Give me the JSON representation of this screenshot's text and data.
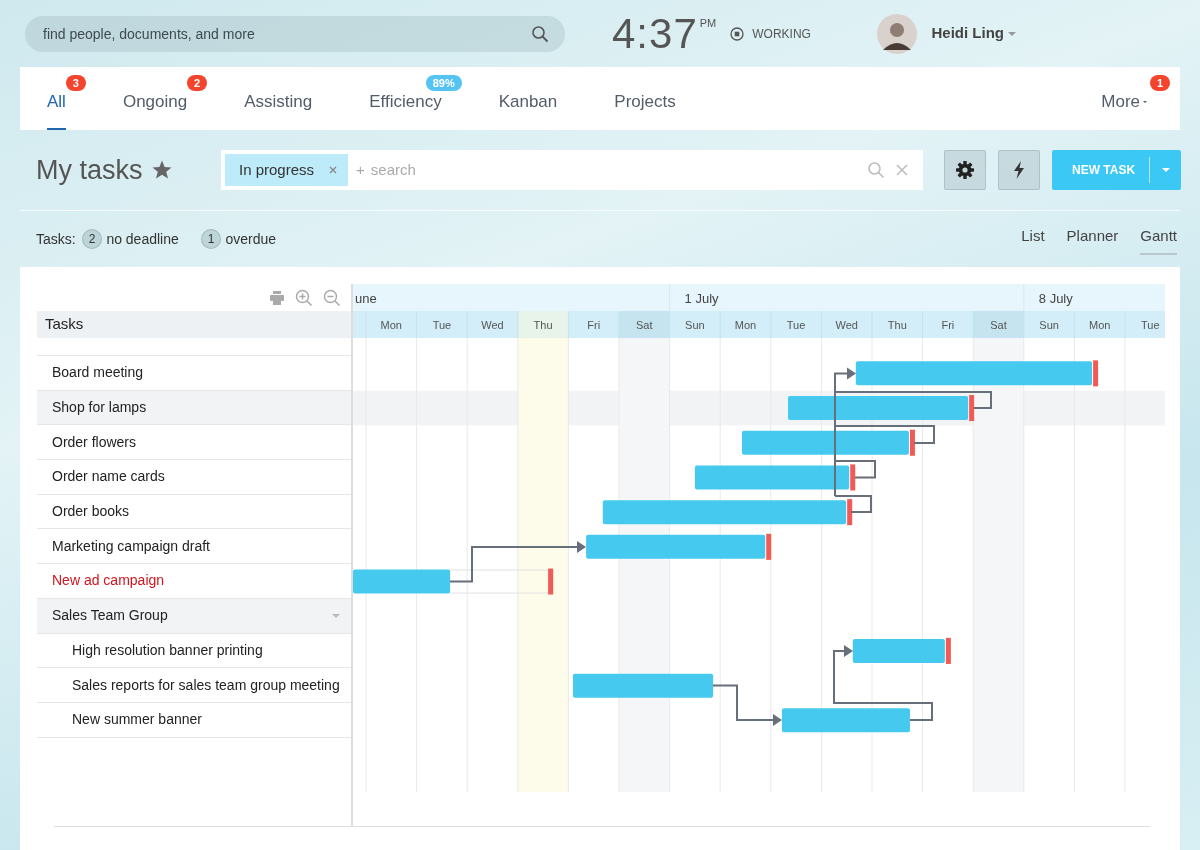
{
  "search": {
    "placeholder": "find people, documents, and more"
  },
  "clock": {
    "time": "4:37",
    "period": "PM"
  },
  "status": {
    "label": "WORKING"
  },
  "user": {
    "name": "Heidi Ling"
  },
  "tabs": [
    {
      "label": "All",
      "selected": true,
      "badge": {
        "text": "3",
        "color": "#f4442e"
      }
    },
    {
      "label": "Ongoing",
      "selected": false,
      "badge": {
        "text": "2",
        "color": "#f4442e"
      }
    },
    {
      "label": "Assisting",
      "selected": false
    },
    {
      "label": "Efficiency",
      "selected": false,
      "badge": {
        "text": "89%",
        "color": "#55c4f2"
      }
    },
    {
      "label": "Kanban",
      "selected": false
    },
    {
      "label": "Projects",
      "selected": false
    },
    {
      "label": "More",
      "selected": false,
      "dropdown": true,
      "badge": {
        "text": "1",
        "color": "#f4442e"
      }
    }
  ],
  "page": {
    "title": "My tasks"
  },
  "filter": {
    "tags": [
      {
        "label": "In progress"
      }
    ],
    "prefix": "+",
    "placeholder": "search"
  },
  "actions": {
    "new_task": "NEW TASK"
  },
  "counters": {
    "label": "Tasks:",
    "items": [
      {
        "count": "2",
        "label": "no deadline"
      },
      {
        "count": "1",
        "label": "overdue"
      }
    ]
  },
  "views": [
    {
      "label": "List",
      "selected": false
    },
    {
      "label": "Planner",
      "selected": false
    },
    {
      "label": "Gantt",
      "selected": true
    }
  ],
  "gantt": {
    "column_header": "Tasks",
    "months": [
      {
        "label": "une",
        "days": [
          {
            "label": "Mon",
            "kind": "weekday"
          },
          {
            "label": "Tue",
            "kind": "weekday"
          },
          {
            "label": "Wed",
            "kind": "weekday"
          },
          {
            "label": "Thu",
            "kind": "today"
          },
          {
            "label": "Fri",
            "kind": "weekday"
          },
          {
            "label": "Sat",
            "kind": "weekend"
          }
        ]
      },
      {
        "label": "1 July",
        "days": [
          {
            "label": "Sun",
            "kind": "weekday"
          },
          {
            "label": "Mon",
            "kind": "weekday"
          },
          {
            "label": "Tue",
            "kind": "weekday"
          },
          {
            "label": "Wed",
            "kind": "weekday"
          },
          {
            "label": "Thu",
            "kind": "weekday"
          },
          {
            "label": "Fri",
            "kind": "weekday"
          },
          {
            "label": "Sat",
            "kind": "weekend"
          }
        ]
      },
      {
        "label": "8 July",
        "days": [
          {
            "label": "Sun",
            "kind": "weekday"
          },
          {
            "label": "Mon",
            "kind": "weekday"
          },
          {
            "label": "Tue",
            "kind": "weekday"
          }
        ]
      }
    ],
    "rows": [
      {
        "name": "Board meeting",
        "kind": "task",
        "selected": false,
        "overdue": false,
        "deadline": true
      },
      {
        "name": "Shop for lamps",
        "kind": "task",
        "selected": true,
        "overdue": false,
        "deadline": true
      },
      {
        "name": "Order flowers",
        "kind": "task",
        "selected": false,
        "overdue": false,
        "deadline": true
      },
      {
        "name": "Order name cards",
        "kind": "task",
        "selected": false,
        "overdue": false,
        "deadline": true
      },
      {
        "name": "Order books",
        "kind": "task",
        "selected": false,
        "overdue": false,
        "deadline": true
      },
      {
        "name": "Marketing campaign draft",
        "kind": "task",
        "selected": false,
        "overdue": false,
        "deadline": true
      },
      {
        "name": "New ad campaign",
        "kind": "task",
        "selected": false,
        "overdue": true,
        "deadline": true
      },
      {
        "name": "Sales Team Group",
        "kind": "group",
        "selected": false,
        "overdue": false,
        "expanded": true,
        "children": [
          {
            "name": "High resolution banner printing",
            "kind": "task",
            "selected": false,
            "overdue": false,
            "deadline": true
          },
          {
            "name": "Sales reports for sales team group meeting",
            "kind": "task",
            "selected": false,
            "overdue": false,
            "deadline": false
          },
          {
            "name": "New summer banner",
            "kind": "task",
            "selected": false,
            "overdue": false,
            "deadline": false
          }
        ]
      }
    ]
  }
}
